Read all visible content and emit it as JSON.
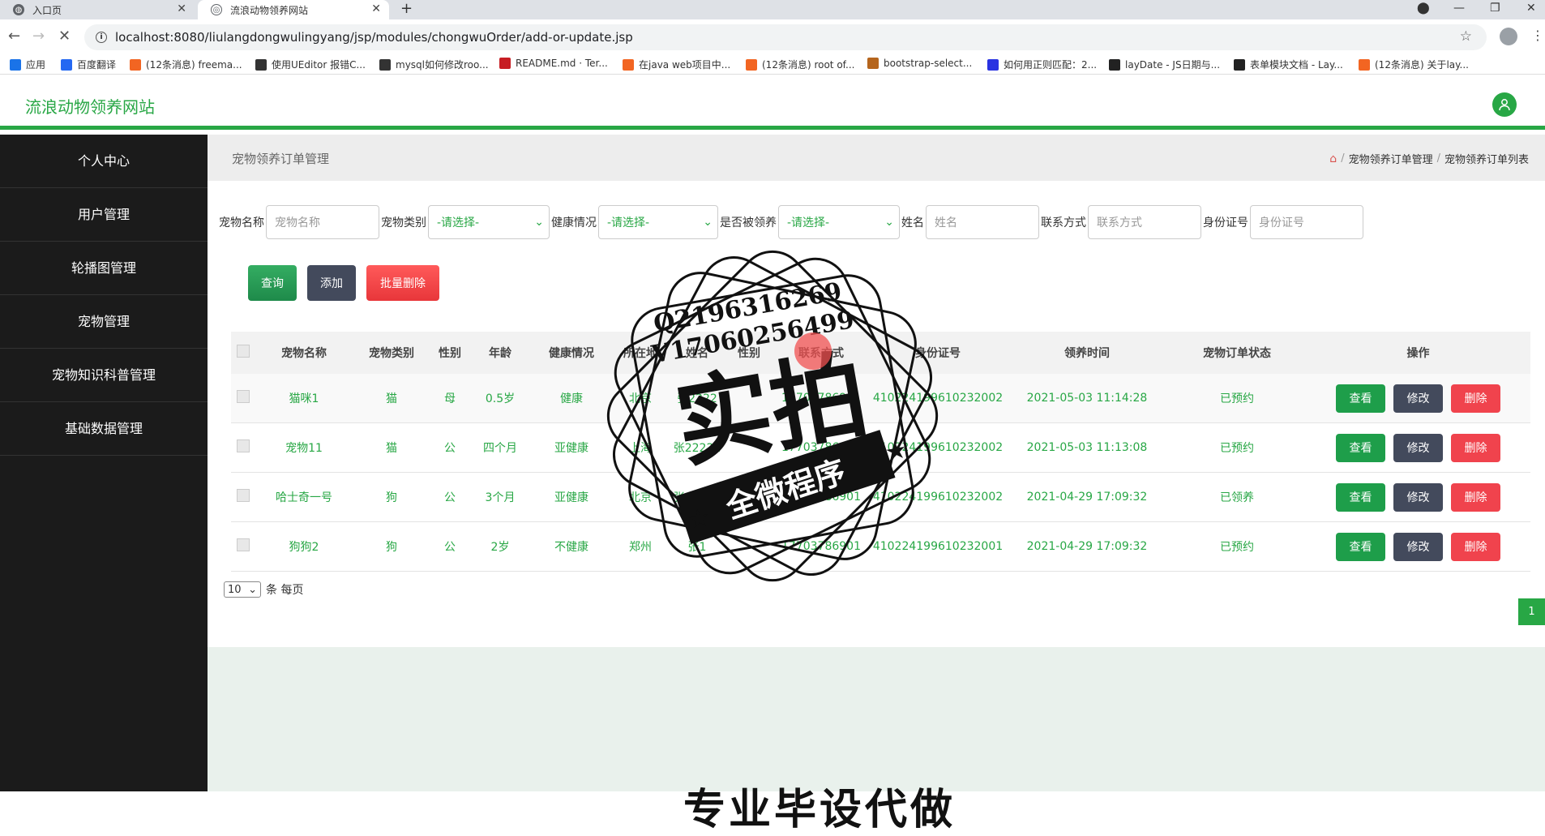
{
  "browser": {
    "tabs": [
      {
        "title": "入口页",
        "active": false
      },
      {
        "title": "流浪动物领养网站",
        "active": true
      }
    ],
    "url": "localhost:8080/liulangdongwulingyang/jsp/modules/chongwuOrder/add-or-update.jsp",
    "bookmarks": [
      {
        "label": "应用",
        "icon": "apps-grid-icon",
        "color": "#1a73e8"
      },
      {
        "label": "百度翻译",
        "icon": "baidu-translate-icon",
        "color": "#2468f2"
      },
      {
        "label": "(12条消息) freema...",
        "icon": "csdn-icon",
        "color": "#f26522"
      },
      {
        "label": "使用UEditor 报错C...",
        "icon": "ueditor-icon",
        "color": "#333"
      },
      {
        "label": "mysql如何修改roo...",
        "icon": "mysql-icon",
        "color": "#333"
      },
      {
        "label": "README.md · Ter...",
        "icon": "gitee-icon",
        "color": "#c71d23"
      },
      {
        "label": "在java web项目中...",
        "icon": "csdn-icon",
        "color": "#f26522"
      },
      {
        "label": "(12条消息) root of...",
        "icon": "csdn-icon",
        "color": "#f26522"
      },
      {
        "label": "bootstrap-select...",
        "icon": "bootstrap-icon",
        "color": "#b5651d"
      },
      {
        "label": "如何用正则匹配：2...",
        "icon": "baidu-paw-icon",
        "color": "#2932e1"
      },
      {
        "label": "layDate - JS日期与...",
        "icon": "layui-icon",
        "color": "#222"
      },
      {
        "label": "表单模块文档 - Lay...",
        "icon": "layui-icon",
        "color": "#222"
      },
      {
        "label": "(12条消息) 关于lay...",
        "icon": "csdn-icon",
        "color": "#f26522"
      }
    ]
  },
  "app": {
    "brand": "流浪动物领养网站",
    "accent": "#28a745",
    "sidebar": [
      "个人中心",
      "用户管理",
      "轮播图管理",
      "宠物管理",
      "宠物知识科普管理",
      "基础数据管理"
    ],
    "page_title": "宠物领养订单管理",
    "breadcrumb": [
      "宠物领养订单管理",
      "宠物领养订单列表"
    ],
    "filters": {
      "pet_name_label": "宠物名称",
      "pet_name_placeholder": "宠物名称",
      "pet_type_label": "宠物类别",
      "pet_type_value": "-请选择-",
      "health_label": "健康情况",
      "health_value": "-请选择-",
      "adopted_label": "是否被领养",
      "adopted_value": "-请选择-",
      "name_label": "姓名",
      "name_placeholder": "姓名",
      "phone_label": "联系方式",
      "phone_placeholder": "联系方式",
      "idcard_label": "身份证号",
      "idcard_placeholder": "身份证号"
    },
    "actions": {
      "query": "查询",
      "add": "添加",
      "batch_delete": "批量删除"
    },
    "table": {
      "headers": [
        "宠物名称",
        "宠物类别",
        "性别",
        "年龄",
        "健康情况",
        "所在地",
        "姓名",
        "性别",
        "联系方式",
        "身份证号",
        "领养时间",
        "宠物订单状态",
        "操作"
      ],
      "rows": [
        [
          "猫咪1",
          "猫",
          "母",
          "0.5岁",
          "健康",
          "北京",
          "张2222",
          "",
          "17703786901",
          "410224199610232002",
          "2021-05-03 11:14:28",
          "已预约"
        ],
        [
          "宠物11",
          "猫",
          "公",
          "四个月",
          "亚健康",
          "上海",
          "张22222",
          "",
          "17703786902",
          "410224199610232002",
          "2021-05-03 11:13:08",
          "已预约"
        ],
        [
          "哈士奇一号",
          "狗",
          "公",
          "3个月",
          "亚健康",
          "北京",
          "张22222",
          "女",
          "17703786901",
          "410224199610232002",
          "2021-04-29 17:09:32",
          "已领养"
        ],
        [
          "狗狗2",
          "狗",
          "公",
          "2岁",
          "不健康",
          "郑州",
          "张1",
          "",
          "17703786901",
          "410224199610232001",
          "2021-04-29 17:09:32",
          "已预约"
        ]
      ],
      "row_ops": {
        "view": "查看",
        "edit": "修改",
        "delete": "删除"
      }
    },
    "pagination": {
      "page_size": "10",
      "page_size_suffix": "条 每页",
      "current_page": "1"
    },
    "footer_banner": "专业毕设代做"
  },
  "watermark": {
    "line1": "Q2196316269",
    "line2": "V17060256499",
    "big": "实拍",
    "ribbon": "全微程序"
  }
}
